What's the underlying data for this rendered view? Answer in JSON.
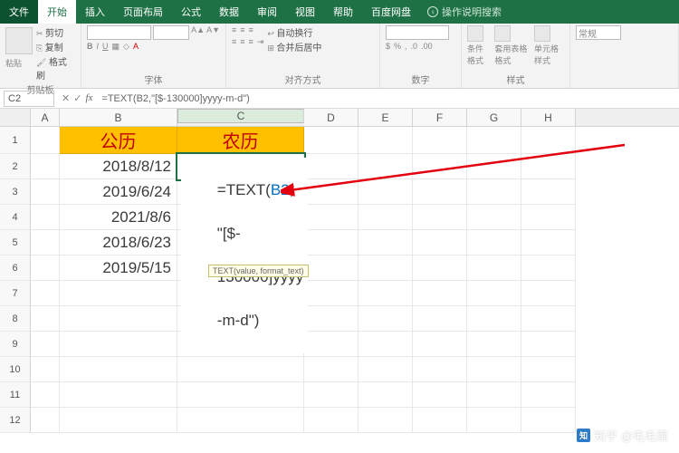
{
  "tabs": [
    "文件",
    "开始",
    "插入",
    "页面布局",
    "公式",
    "数据",
    "审阅",
    "视图",
    "帮助",
    "百度网盘"
  ],
  "active_tab_index": 1,
  "search_hint": "操作说明搜索",
  "ribbon": {
    "clipboard": {
      "cut": "剪切",
      "copy": "复制",
      "paste": "粘贴",
      "format": "格式刷",
      "label": "剪贴板"
    },
    "font_label": "字体",
    "align_label": "对齐方式",
    "align": {
      "wrap": "自动换行",
      "merge": "合并后居中"
    },
    "number_label": "数字",
    "styles": {
      "cond": "条件格式",
      "table": "套用表格格式",
      "cell": "单元格样式",
      "label": "样式"
    },
    "general": "常规"
  },
  "namebox": "C2",
  "formula": "=TEXT(B2,\"[$-130000]yyyy-m-d\")",
  "columns": [
    "A",
    "B",
    "C",
    "D",
    "E",
    "F",
    "G",
    "H"
  ],
  "col_widths": [
    "w-a",
    "w-b",
    "w-c",
    "w-narrow",
    "w-narrow",
    "w-narrow",
    "w-narrow",
    "w-narrow"
  ],
  "header_row": {
    "b": "公历",
    "c": "农历"
  },
  "b_values": [
    "2018/8/12",
    "2019/6/24",
    "2021/8/6",
    "2018/6/23",
    "2019/5/15"
  ],
  "editing_cell": {
    "line1_prefix": "=TEXT(",
    "line1_ref": "B2",
    "line1_suffix": ",",
    "line2": "\"[$-",
    "line3": "130000]yyyy",
    "line4": "-m-d\")"
  },
  "tooltip": "TEXT(value, format_text)",
  "watermark": "知乎 @毛毛雨"
}
